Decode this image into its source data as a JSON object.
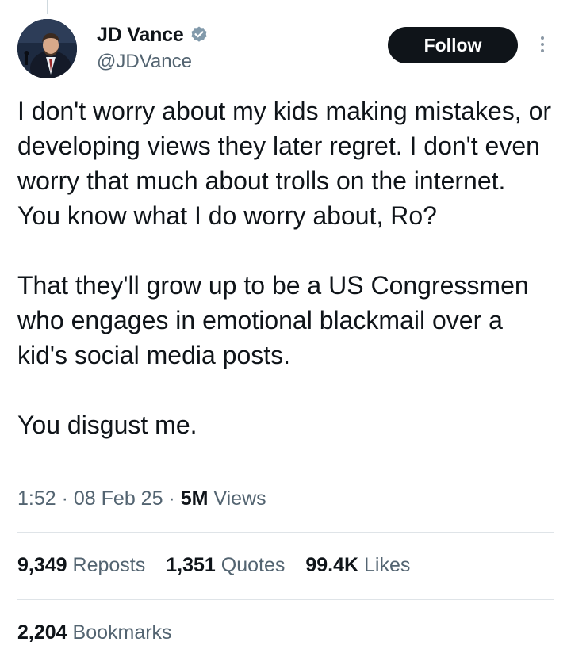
{
  "author": {
    "display_name": "JD Vance",
    "handle": "@JDVance",
    "verified_icon": "verified-badge-icon",
    "avatar_icon": "profile-photo"
  },
  "actions": {
    "follow_label": "Follow",
    "more_icon": "more-vertical-icon"
  },
  "tweet": {
    "paragraphs": [
      "I don't worry about my kids making mistakes, or developing views they later regret. I don't even worry that much about trolls on the internet. You know what I do worry about, Ro?",
      "That they'll grow up to be a US Congressmen who engages in emotional blackmail over a kid's social media posts.",
      "You disgust me."
    ]
  },
  "meta": {
    "time": "1:52",
    "separator": " · ",
    "date": "08 Feb 25",
    "views_count": "5M",
    "views_label": "Views"
  },
  "stats": {
    "reposts_count": "9,349",
    "reposts_label": "Reposts",
    "quotes_count": "1,351",
    "quotes_label": "Quotes",
    "likes_count": "99.4K",
    "likes_label": "Likes",
    "bookmarks_count": "2,204",
    "bookmarks_label": "Bookmarks"
  },
  "colors": {
    "text_primary": "#0f1419",
    "text_secondary": "#536471",
    "follow_bg": "#0f1419",
    "verified_blue": "#829aab"
  }
}
